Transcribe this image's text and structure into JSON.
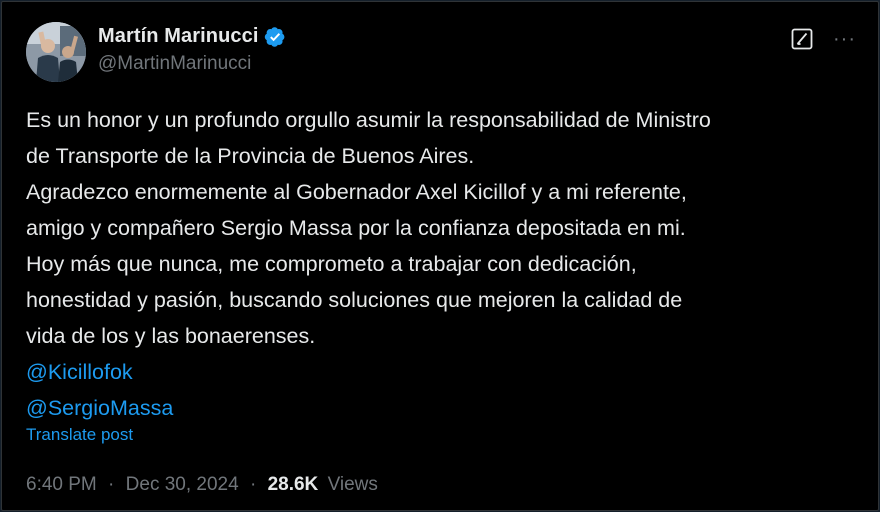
{
  "author": {
    "display_name": "Martín Marinucci",
    "handle": "@MartinMarinucci",
    "verified": true,
    "avatar_icon": "profile-photo"
  },
  "actions": {
    "grok_icon": "grok-icon",
    "more_label": "···"
  },
  "post": {
    "lines": [
      "Es un honor y un profundo orgullo asumir la responsabilidad de Ministro",
      "de Transporte de la Provincia de Buenos Aires.",
      "Agradezco enormemente al Gobernador Axel Kicillof y a mi referente,",
      "amigo y compañero Sergio Massa por la confianza depositada en mi.",
      "Hoy más que nunca, me comprometo a trabajar con dedicación,",
      "honestidad y pasión, buscando soluciones que mejoren la calidad de",
      "vida de los y las bonaerenses."
    ],
    "mentions": [
      "@Kicillofok",
      "@SergioMassa"
    ],
    "translate_label": "Translate post"
  },
  "meta": {
    "time": "6:40 PM",
    "date": "Dec 30, 2024",
    "separator": "·",
    "views_count": "28.6K",
    "views_label": "Views"
  },
  "colors": {
    "background": "#000000",
    "text": "#e7e9ea",
    "muted": "#71767b",
    "link": "#1d9bf0",
    "verified": "#1d9bf0"
  }
}
